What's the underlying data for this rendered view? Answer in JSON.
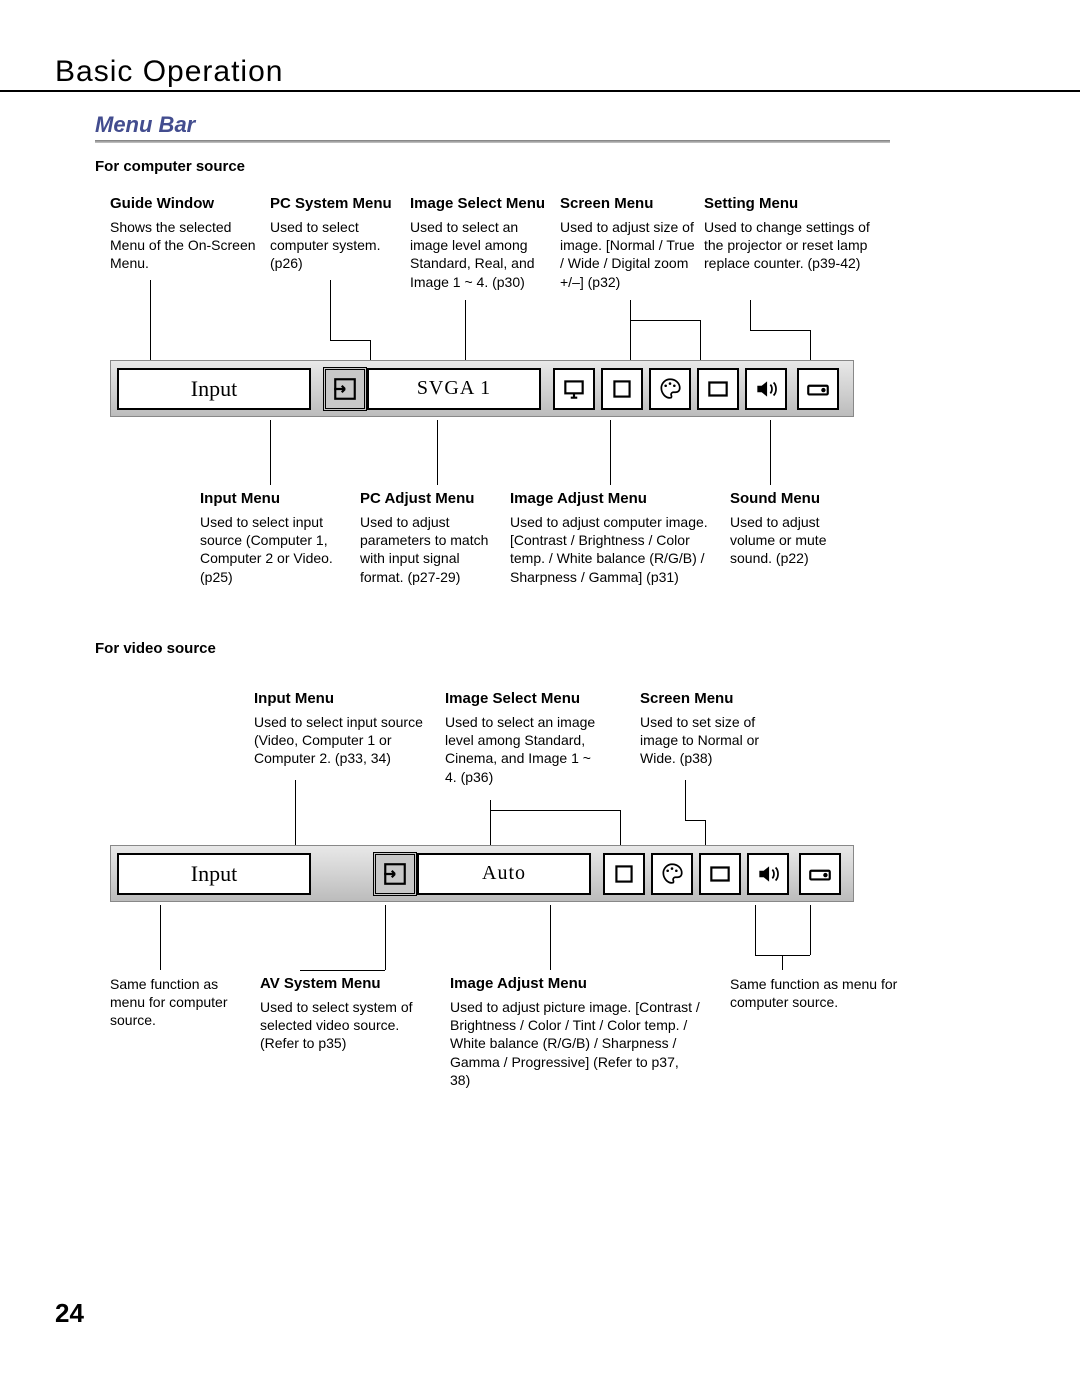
{
  "header": "Basic Operation",
  "section": "Menu Bar",
  "pageNumber": "24",
  "comp": {
    "heading": "For computer source",
    "top": {
      "guide": {
        "title": "Guide Window",
        "text": "Shows the selected Menu of the On-Screen Menu."
      },
      "pcsys": {
        "title": "PC System Menu",
        "text": "Used to select computer system. (p26)"
      },
      "imgsel": {
        "title": "Image Select Menu",
        "text": "Used to select  an image level among Standard, Real, and Image 1 ~ 4. (p30)"
      },
      "screen": {
        "title": "Screen Menu",
        "text": "Used to adjust size of image.  [Normal / True / Wide / Digital zoom +/–] (p32)"
      },
      "setting": {
        "title": "Setting Menu",
        "text": "Used to change settings of the projector or reset  lamp replace counter. (p39-42)"
      }
    },
    "bar": {
      "guide": "Input",
      "system": "SVGA 1"
    },
    "bottom": {
      "input": {
        "title": "Input Menu",
        "text": "Used to select input source (Computer 1, Computer 2 or Video. (p25)"
      },
      "pcadj": {
        "title": "PC Adjust Menu",
        "text": "Used to adjust parameters to match with input signal format. (p27-29)"
      },
      "imgadj": {
        "title": "Image Adjust Menu",
        "text": "Used to adjust computer image. [Contrast / Brightness / Color temp. /  White balance (R/G/B) / Sharpness /  Gamma]   (p31)"
      },
      "sound": {
        "title": "Sound Menu",
        "text": "Used to adjust volume or mute sound.  (p22)"
      }
    }
  },
  "vid": {
    "heading": "For video source",
    "top": {
      "input": {
        "title": "Input Menu",
        "text": "Used to select input source (Video, Computer 1 or Computer 2. (p33, 34)"
      },
      "imgsel": {
        "title": "Image Select Menu",
        "text": "Used to select an image level among Standard, Cinema, and Image 1 ~ 4. (p36)"
      },
      "screen": {
        "title": "Screen Menu",
        "text": "Used to set size of image to Normal or Wide. (p38)"
      }
    },
    "bar": {
      "guide": "Input",
      "system": "Auto"
    },
    "bottom": {
      "same1": {
        "text": "Same function as menu for computer source."
      },
      "avsys": {
        "title": "AV System Menu",
        "text": "Used to select system of selected video source. (Refer to p35)"
      },
      "imgadj": {
        "title": "Image Adjust Menu",
        "text": " Used to adjust picture image. [Contrast / Brightness / Color / Tint / Color temp. / White balance (R/G/B) / Sharpness /  Gamma / Progressive] (Refer to p37, 38)"
      },
      "same2": {
        "text": "Same function as menu for computer source."
      }
    }
  }
}
